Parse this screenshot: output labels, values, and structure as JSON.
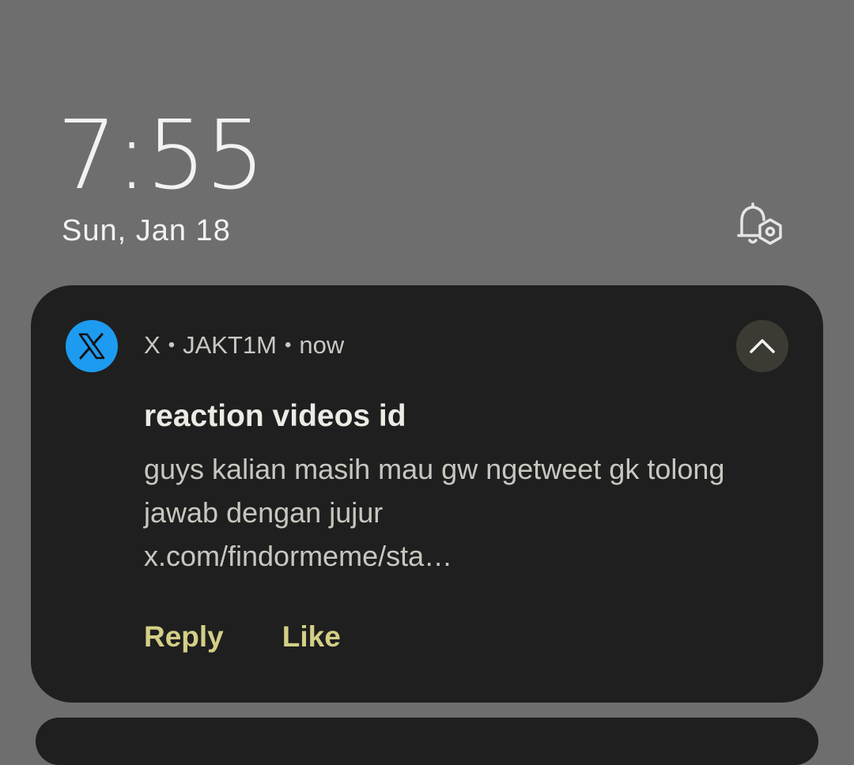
{
  "lockscreen": {
    "time": "7:55",
    "date": "Sun, Jan 18",
    "notification_settings_icon": "bell-settings-icon"
  },
  "notification": {
    "app_icon": "x-logo-icon",
    "app_name": "X",
    "account": "JAKT1M",
    "separator": "•",
    "timestamp": "now",
    "title": "reaction videos id",
    "body_lines": [
      "guys kalian masih mau gw ngetweet gk tolong",
      "jawab dengan jujur",
      "x.com/findormeme/sta…"
    ],
    "actions": {
      "reply": "Reply",
      "like": "Like"
    },
    "expand_icon": "chevron-up-icon"
  },
  "colors": {
    "background": "#6e6e6e",
    "card": "#1f1f1f",
    "app_icon": "#1d9bf0",
    "action": "#d4cf86"
  }
}
